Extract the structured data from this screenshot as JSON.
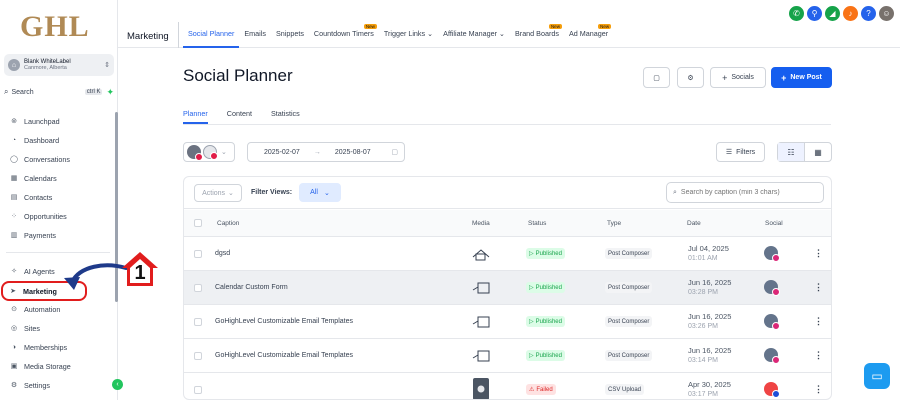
{
  "brand": {
    "logo_text": "GHL"
  },
  "account": {
    "name": "Blank WhiteLabel",
    "location": "Canmore, Alberta"
  },
  "sidebar": {
    "search_label": "Search",
    "search_shortcut": "ctrl K",
    "items": [
      {
        "label": "Launchpad",
        "icon": "rocket-icon"
      },
      {
        "label": "Dashboard",
        "icon": "dashboard-icon"
      },
      {
        "label": "Conversations",
        "icon": "chat-icon"
      },
      {
        "label": "Calendars",
        "icon": "calendar-icon"
      },
      {
        "label": "Contacts",
        "icon": "contacts-icon"
      },
      {
        "label": "Opportunities",
        "icon": "opportunities-icon"
      },
      {
        "label": "Payments",
        "icon": "payments-icon"
      },
      {
        "label": "AI Agents",
        "icon": "ai-icon"
      },
      {
        "label": "Marketing",
        "icon": "send-icon"
      },
      {
        "label": "Automation",
        "icon": "automation-icon"
      },
      {
        "label": "Sites",
        "icon": "globe-icon"
      },
      {
        "label": "Memberships",
        "icon": "memberships-icon"
      },
      {
        "label": "Media Storage",
        "icon": "storage-icon"
      },
      {
        "label": "Settings",
        "icon": "gear-icon"
      }
    ]
  },
  "annotation": {
    "number": "1"
  },
  "topbar": {
    "module": "Marketing",
    "tabs": [
      {
        "label": "Social Planner",
        "new": false
      },
      {
        "label": "Emails",
        "new": false
      },
      {
        "label": "Snippets",
        "new": false
      },
      {
        "label": "Countdown Timers",
        "new": true
      },
      {
        "label": "Trigger Links",
        "new": false
      },
      {
        "label": "Affiliate Manager",
        "new": false
      },
      {
        "label": "Brand Boards",
        "new": true
      },
      {
        "label": "Ad Manager",
        "new": true
      }
    ],
    "new_badge": "New"
  },
  "page": {
    "title": "Social Planner",
    "socials_label": "Socials",
    "new_post_label": "New Post",
    "subtabs": [
      "Planner",
      "Content",
      "Statistics"
    ],
    "date_from": "2025-02-07",
    "date_to": "2025-08-07",
    "filters_label": "Filters"
  },
  "table": {
    "actions_label": "Actions",
    "filter_views_label": "Filter Views:",
    "filter_view_value": "All",
    "search_placeholder": "Search by caption (min 3 chars)",
    "columns": [
      "Caption",
      "Media",
      "Status",
      "Type",
      "Date",
      "Social"
    ],
    "rows": [
      {
        "caption": "dgsd",
        "status": "Published",
        "type": "Post Composer",
        "date": "Jul 04, 2025",
        "time": "01:01 AM"
      },
      {
        "caption": "Calendar Custom Form",
        "status": "Published",
        "type": "Post Composer",
        "date": "Jun 16, 2025",
        "time": "03:28 PM"
      },
      {
        "caption": "GoHighLevel Customizable Email Templates",
        "status": "Published",
        "type": "Post Composer",
        "date": "Jun 16, 2025",
        "time": "03:26 PM"
      },
      {
        "caption": "GoHighLevel Customizable Email Templates",
        "status": "Published",
        "type": "Post Composer",
        "date": "Jun 16, 2025",
        "time": "03:14 PM"
      },
      {
        "caption": "",
        "status": "Failed",
        "type": "CSV Upload",
        "date": "Apr 30, 2025",
        "time": "03:17 PM"
      }
    ]
  },
  "colors": {
    "primary": "#155eef",
    "accent_gold": "#b08a55",
    "highlight_red": "#e11d1d"
  }
}
